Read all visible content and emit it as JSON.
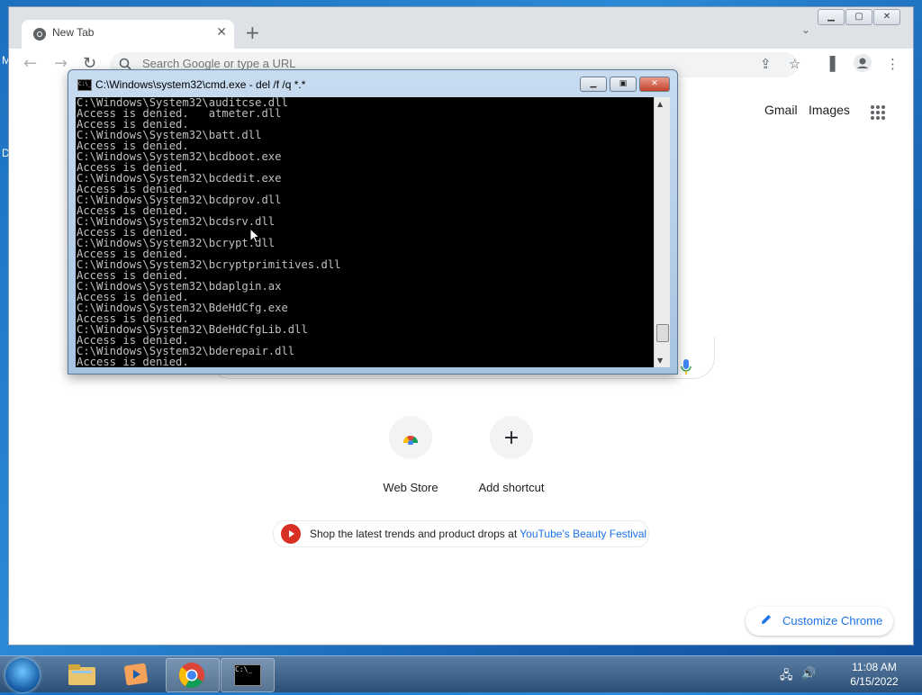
{
  "desktop": {
    "edge_glyph_1": "M",
    "edge_glyph_2": "D"
  },
  "browser": {
    "tab": {
      "title": "New Tab"
    },
    "omnibox": {
      "placeholder": "Search Google or type a URL"
    },
    "top_links": {
      "gmail": "Gmail",
      "images": "Images"
    },
    "shortcuts": [
      {
        "label": "Web Store",
        "icon": "chrome-webstore-icon"
      },
      {
        "label": "Add shortcut",
        "icon": "plus-icon"
      }
    ],
    "promo": {
      "text": "Shop the latest trends and product drops at ",
      "link": "YouTube's Beauty Festival"
    },
    "customize_label": "Customize Chrome",
    "colors": {
      "accent": "#1a73e8",
      "tab_strip": "#dee1e6"
    }
  },
  "cmd": {
    "title": "C:\\Windows\\system32\\cmd.exe - del  /f /q *.*",
    "lines": [
      "C:\\Windows\\System32\\auditcse.dll",
      "Access is denied.   atmeter.dll",
      "Access is denied.",
      "C:\\Windows\\System32\\batt.dll",
      "Access is denied.",
      "C:\\Windows\\System32\\bcdboot.exe",
      "Access is denied.",
      "C:\\Windows\\System32\\bcdedit.exe",
      "Access is denied.",
      "C:\\Windows\\System32\\bcdprov.dll",
      "Access is denied.",
      "C:\\Windows\\System32\\bcdsrv.dll",
      "Access is denied.",
      "C:\\Windows\\System32\\bcrypt.dll",
      "Access is denied.",
      "C:\\Windows\\System32\\bcryptprimitives.dll",
      "Access is denied.",
      "C:\\Windows\\System32\\bdaplgin.ax",
      "Access is denied.",
      "C:\\Windows\\System32\\BdeHdCfg.exe",
      "Access is denied.",
      "C:\\Windows\\System32\\BdeHdCfgLib.dll",
      "Access is denied.",
      "C:\\Windows\\System32\\bderepair.dll",
      "Access is denied."
    ],
    "scroll_position": 0.9
  },
  "taskbar": {
    "time": "11:08 AM",
    "date": "6/15/2022",
    "items": [
      "explorer-icon",
      "media-player-icon",
      "chrome-icon",
      "cmd-icon"
    ]
  }
}
